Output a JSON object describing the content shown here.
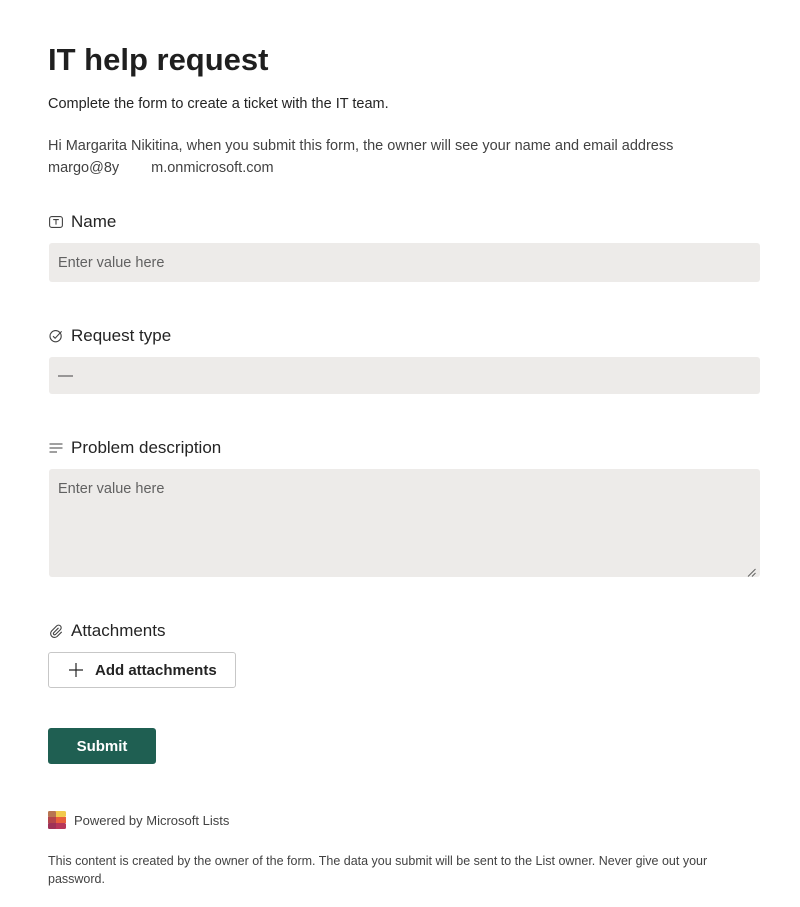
{
  "form": {
    "title": "IT help request",
    "subtitle": "Complete the form to create a ticket with the IT team.",
    "notice_line1": "Hi Margarita Nikitina, when you submit this form, the owner will see your name and email address",
    "notice_email_start": "margo@8y",
    "notice_email_end": "m.onmicrosoft.com"
  },
  "fields": {
    "name": {
      "label": "Name",
      "icon": "text-field-icon",
      "placeholder": "Enter value here"
    },
    "request_type": {
      "label": "Request type",
      "icon": "choice-check-icon",
      "value": "—"
    },
    "problem_description": {
      "label": "Problem description",
      "icon": "multiline-text-icon",
      "placeholder": "Enter value here"
    },
    "attachments": {
      "label": "Attachments",
      "icon": "paperclip-icon",
      "button_label": "Add attachments"
    }
  },
  "actions": {
    "submit_label": "Submit"
  },
  "footer": {
    "powered_by": "Powered by Microsoft Lists",
    "disclaimer": "This content is created by the owner of the form. The data you submit will be sent to the List owner. Never give out your password."
  },
  "colors": {
    "submit_bg": "#1f5f52",
    "input_bg": "#edebe9",
    "text": "#242424"
  }
}
